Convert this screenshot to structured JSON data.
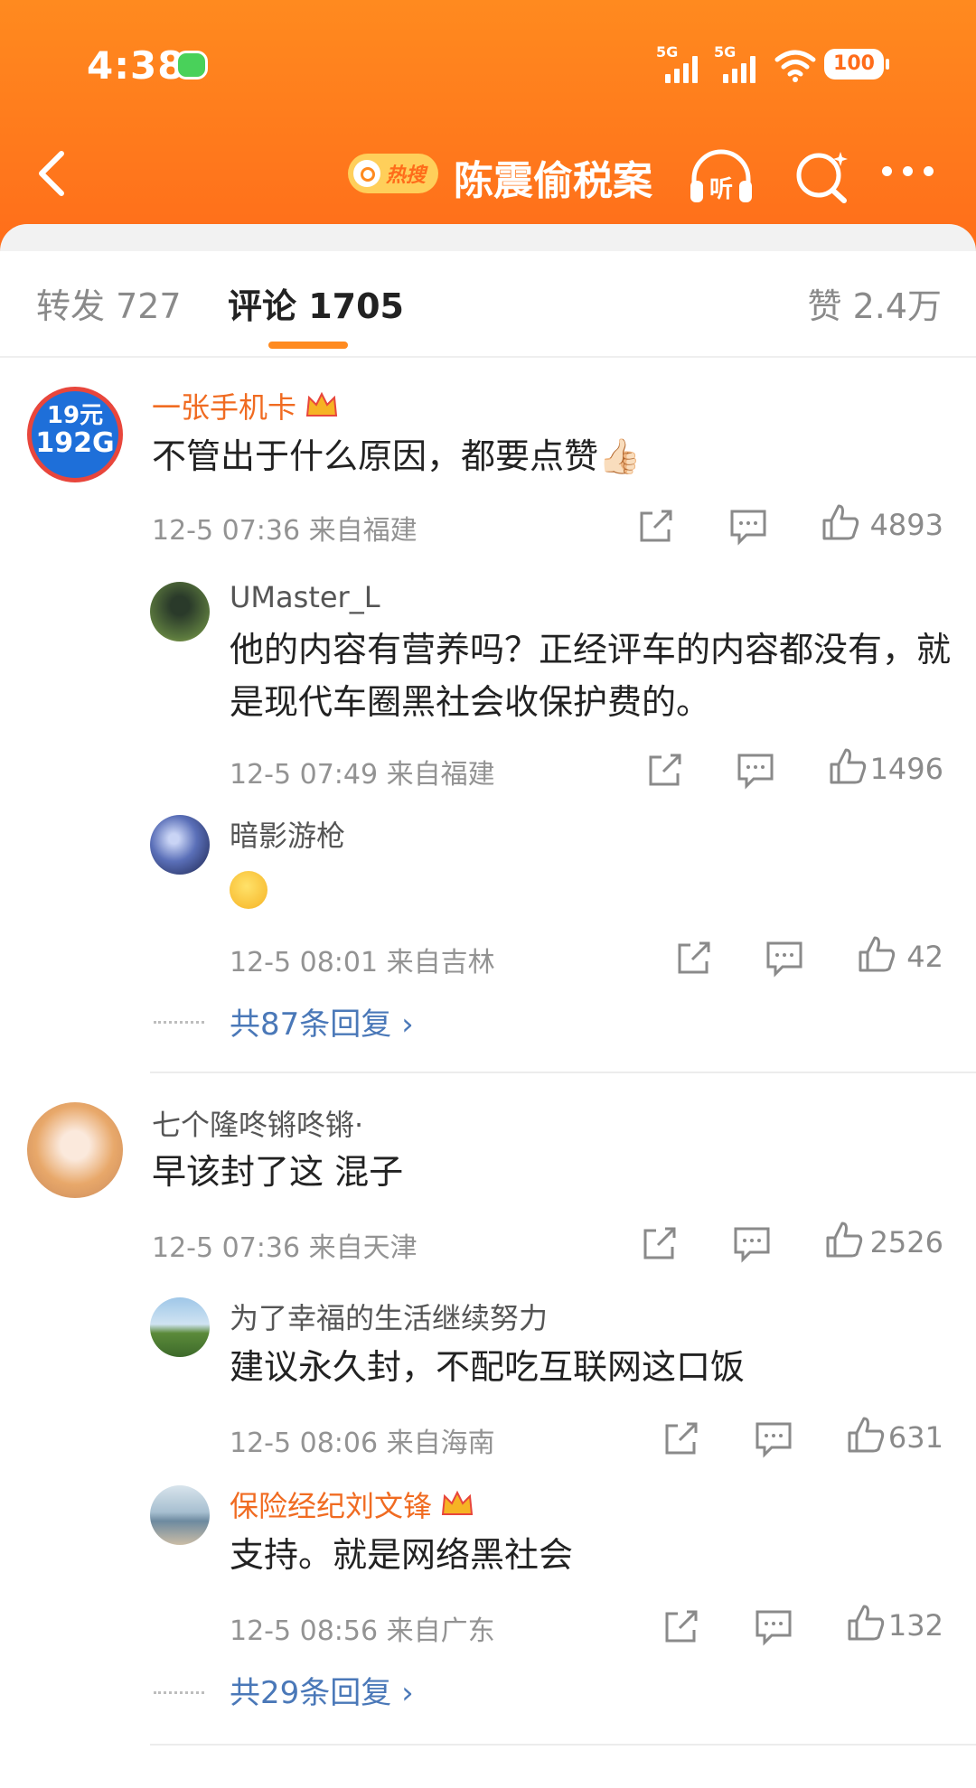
{
  "status_bar": {
    "time": "4:38",
    "signal1": "5G",
    "signal2": "5G",
    "battery": "100"
  },
  "nav": {
    "hot_badge": "热搜",
    "title": "陈震偷税案"
  },
  "tabs": {
    "forward": "转发 727",
    "comments": "评论 1705",
    "likes": "赞 2.4万"
  },
  "threads": [
    {
      "user": "一张手机卡",
      "avatar_text_top": "19元",
      "avatar_text_bottom": "192G",
      "text": "不管出于什么原因，都要点赞👍🏻",
      "meta": "12-5 07:36  来自福建",
      "likes": "4893",
      "replies": [
        {
          "user": "UMaster_L",
          "text": "他的内容有营养吗？正经评车的内容都没有，就是现代车圈黑社会收保护费的。",
          "meta": "12-5 07:49  来自福建",
          "likes": "1496"
        },
        {
          "user": "暗影游枪",
          "text": "😮",
          "meta": "12-5 08:01  来自吉林",
          "likes": "42"
        }
      ],
      "more_replies": "共87条回复 ›"
    },
    {
      "user": "七个隆咚锵咚锵·",
      "text": "早该封了这 混子",
      "meta": "12-5 07:36  来自天津",
      "likes": "2526",
      "replies": [
        {
          "user": "为了幸福的生活继续努力",
          "text": "建议永久封，不配吃互联网这口饭",
          "meta": "12-5 08:06  来自海南",
          "likes": "631"
        },
        {
          "user": "保险经纪刘文锋",
          "text": "支持。就是网络黑社会",
          "meta": "12-5 08:56  来自广东",
          "likes": "132"
        }
      ],
      "more_replies": "共29条回复 ›"
    }
  ]
}
